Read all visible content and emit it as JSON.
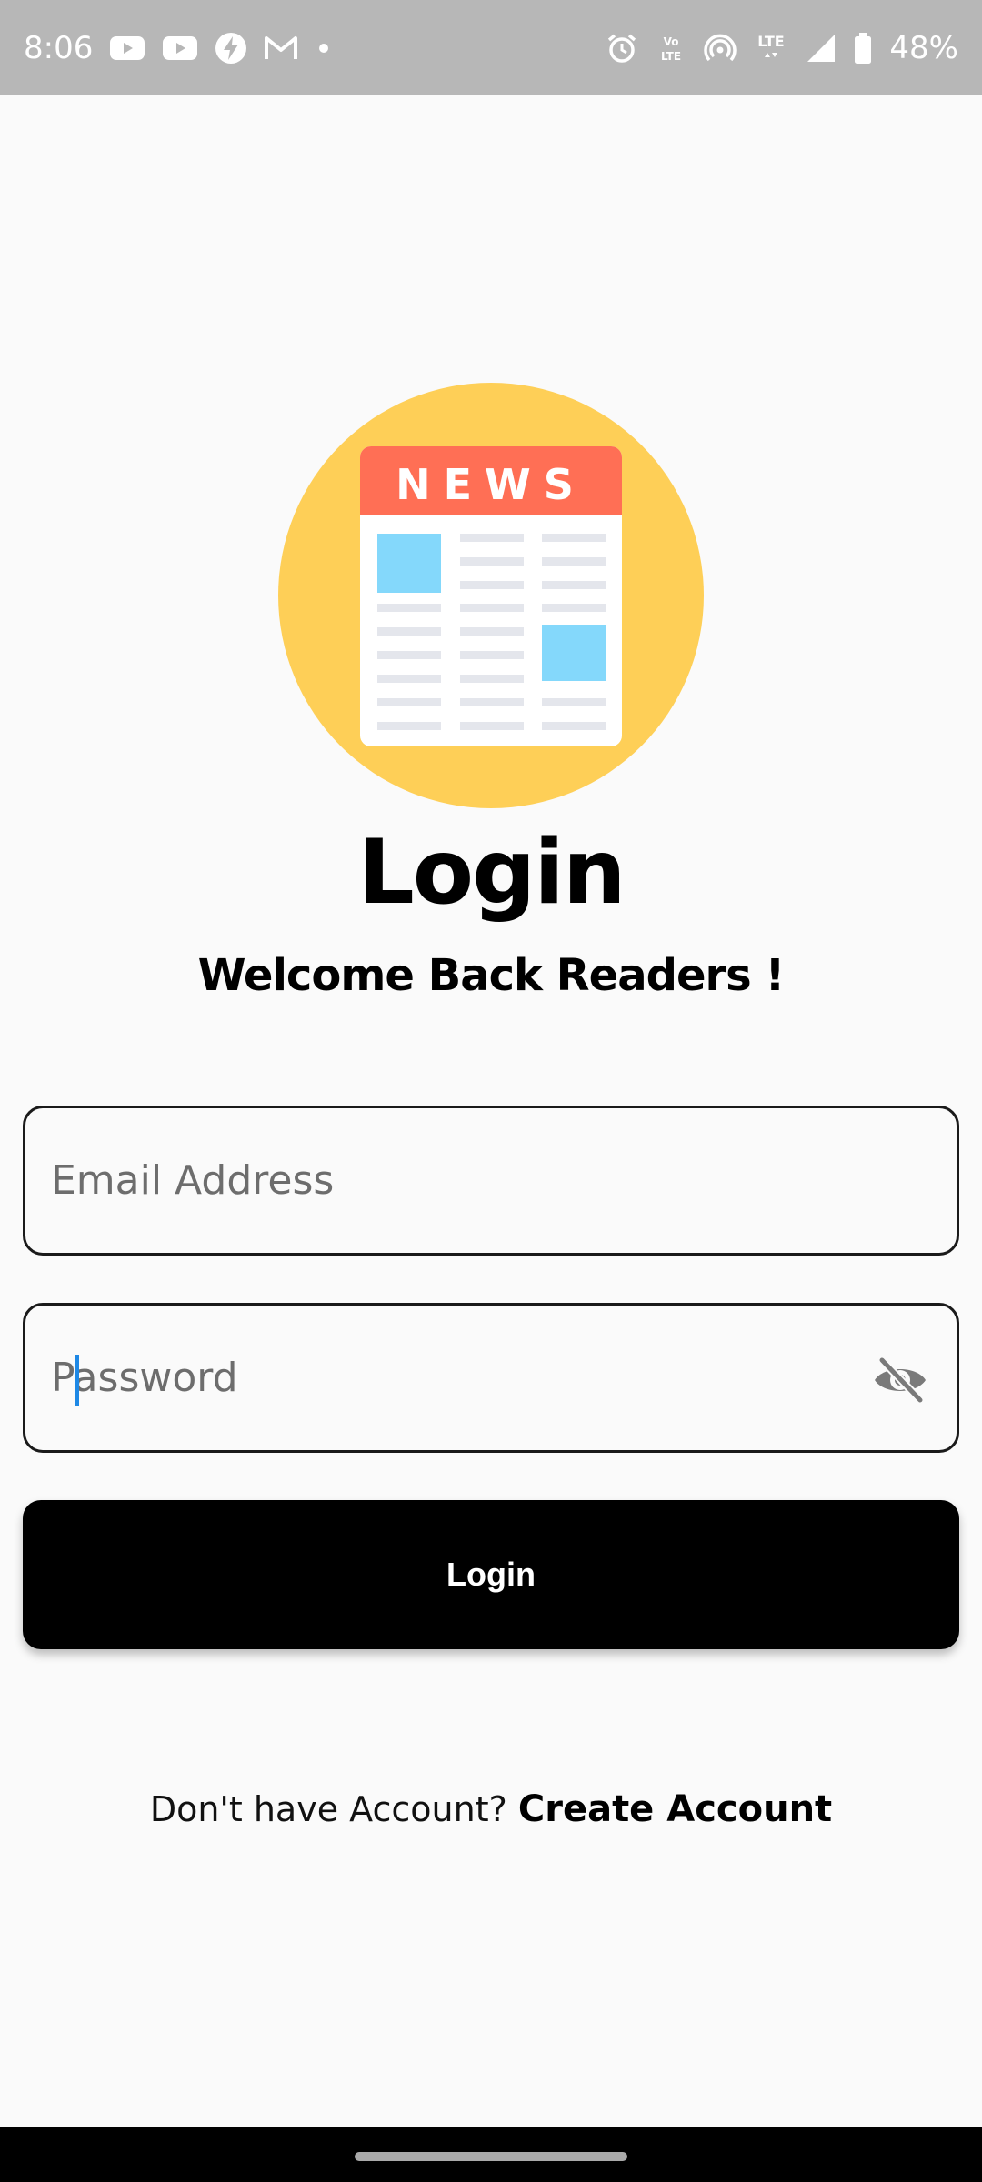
{
  "status_bar": {
    "time": "8:06",
    "battery_percent": "48%",
    "network": "LTE",
    "notification_icons": [
      "youtube-icon",
      "youtube-icon",
      "messenger-icon",
      "gmail-icon",
      "dot-icon"
    ],
    "system_icons": [
      "alarm-icon",
      "volte-icon",
      "hotspot-icon",
      "lte-icon",
      "signal-icon",
      "battery-icon"
    ]
  },
  "logo": {
    "banner_text": "NEWS",
    "colors": {
      "circle": "#fecf57",
      "banner": "#ff6f55",
      "image_blocks": "#84d8fb",
      "lines": "#e4e6ec"
    }
  },
  "header": {
    "title": "Login",
    "subtitle": "Welcome Back Readers !"
  },
  "form": {
    "email_placeholder": "Email Address",
    "email_value": "",
    "password_placeholder": "Password",
    "password_value": "",
    "visibility_icon": "eye-off-icon",
    "login_label": "Login"
  },
  "footer": {
    "prompt": "Don't have Account?",
    "link_label": "Create Account"
  },
  "colors": {
    "background": "#fafafa",
    "button": "#000000",
    "caret": "#1e88e5"
  }
}
